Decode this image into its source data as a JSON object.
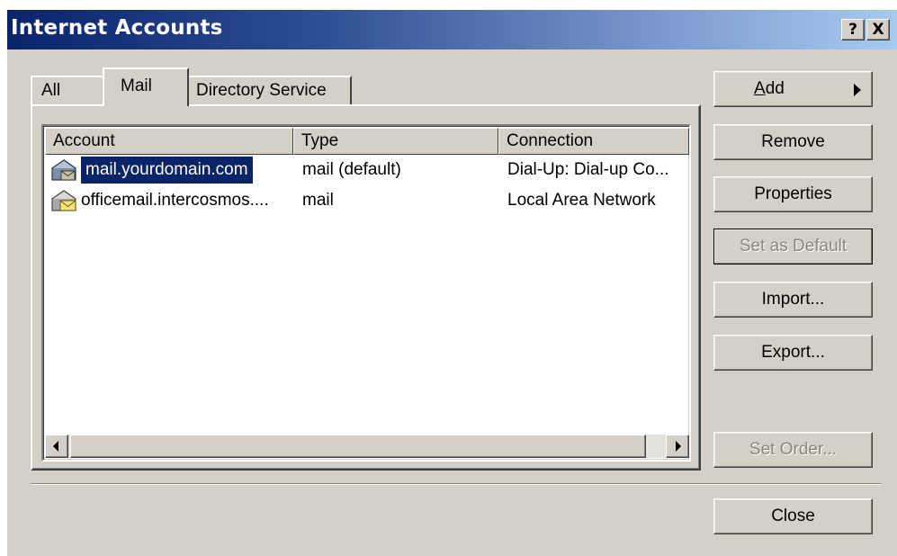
{
  "window": {
    "title": "Internet Accounts",
    "help_button": "?",
    "close_button": "X"
  },
  "tabs": [
    {
      "label": "All"
    },
    {
      "label": "Mail",
      "active": true
    },
    {
      "label": "Directory Service"
    }
  ],
  "list": {
    "columns": [
      "Account",
      "Type",
      "Connection"
    ],
    "rows": [
      {
        "account": "mail.yourdomain.com",
        "type": "mail (default)",
        "connection": "Dial-Up: Dial-up Co...",
        "icon": "mail-account-default-icon",
        "selected": true
      },
      {
        "account": "officemail.intercosmos....",
        "type": "mail",
        "connection": "Local Area Network",
        "icon": "mail-account-icon",
        "selected": false
      }
    ]
  },
  "buttons": {
    "add": "Add",
    "remove": "Remove",
    "properties": "Properties",
    "set_default": "Set as Default",
    "import": "Import...",
    "export": "Export...",
    "set_order": "Set Order...",
    "close": "Close"
  },
  "colors": {
    "title_gradient_start": "#0a246a",
    "title_gradient_end": "#a6caf0",
    "face": "#d4d0c8",
    "selection": "#0a246a"
  }
}
